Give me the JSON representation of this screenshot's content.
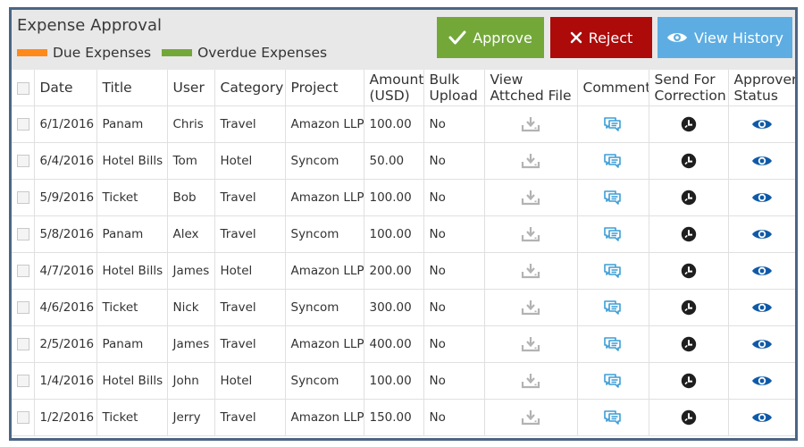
{
  "panel": {
    "title": "Expense Approval",
    "legend": [
      {
        "label": "Due Expenses",
        "color": "#ff8a1c"
      },
      {
        "label": "Overdue Expenses",
        "color": "#73a839"
      }
    ]
  },
  "actions": {
    "approve_label": "Approve",
    "reject_label": "Reject",
    "history_label": "View History",
    "colors": {
      "approve": "#73a839",
      "reject": "#ad0a0a",
      "history": "#5dade2"
    }
  },
  "table": {
    "columns": [
      "Date",
      "Title",
      "User",
      "Category",
      "Project",
      "Amount (USD)",
      "Bulk Upload",
      "View Attched File",
      "Comment",
      "Send For Correction",
      "Approver Status"
    ],
    "rows": [
      {
        "date": "6/1/2016",
        "title": "Panam",
        "user": "Chris",
        "category": "Travel",
        "project": "Amazon LLP",
        "amount": "100.00",
        "bulk": "No"
      },
      {
        "date": "6/4/2016",
        "title": "Hotel Bills",
        "user": "Tom",
        "category": "Hotel",
        "project": "Syncom",
        "amount": "50.00",
        "bulk": "No"
      },
      {
        "date": "5/9/2016",
        "title": "Ticket",
        "user": "Bob",
        "category": "Travel",
        "project": "Amazon LLP",
        "amount": "100.00",
        "bulk": "No"
      },
      {
        "date": "5/8/2016",
        "title": "Panam",
        "user": "Alex",
        "category": "Travel",
        "project": "Syncom",
        "amount": "100.00",
        "bulk": "No"
      },
      {
        "date": "4/7/2016",
        "title": "Hotel Bills",
        "user": "James",
        "category": "Hotel",
        "project": "Amazon LLP",
        "amount": "200.00",
        "bulk": "No"
      },
      {
        "date": "4/6/2016",
        "title": "Ticket",
        "user": "Nick",
        "category": "Travel",
        "project": "Syncom",
        "amount": "300.00",
        "bulk": "No"
      },
      {
        "date": "2/5/2016",
        "title": "Panam",
        "user": "James",
        "category": "Travel",
        "project": "Amazon LLP",
        "amount": "400.00",
        "bulk": "No"
      },
      {
        "date": "1/4/2016",
        "title": "Hotel Bills",
        "user": "John",
        "category": "Hotel",
        "project": "Syncom",
        "amount": "100.00",
        "bulk": "No"
      },
      {
        "date": "1/2/2016",
        "title": "Ticket",
        "user": "Jerry",
        "category": "Travel",
        "project": "Amazon LLP",
        "amount": "150.00",
        "bulk": "No"
      }
    ],
    "row_icons": [
      "download-icon",
      "comment-icon",
      "send-back-icon",
      "eye-icon"
    ]
  }
}
